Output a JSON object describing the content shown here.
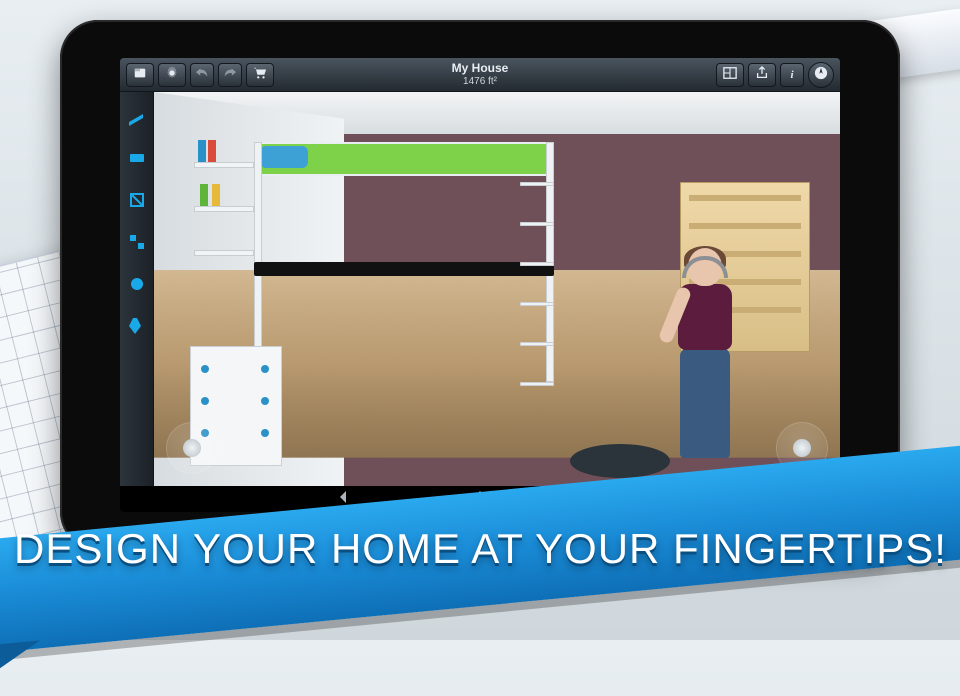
{
  "header": {
    "title": "My House",
    "subtitle": "1476 ft²"
  },
  "toolbar_left": {
    "file": "file-icon",
    "settings": "gear-icon",
    "undo": "undo-icon",
    "redo": "redo-icon",
    "cart": "cart-icon"
  },
  "toolbar_right": {
    "plan2d": "plan2d-icon",
    "share": "share-icon",
    "info": "info-icon",
    "compass": "compass-icon"
  },
  "side_rail": {
    "items": [
      {
        "name": "build-tool"
      },
      {
        "name": "furniture-tool"
      },
      {
        "name": "openings-tool"
      },
      {
        "name": "objects-tool"
      },
      {
        "name": "texture-tool"
      },
      {
        "name": "light-tool"
      }
    ]
  },
  "promo": {
    "tagline": "DESIGN YOUR HOME AT YOUR FINGERTIPS!"
  },
  "colors": {
    "accent": "#1aa9e8",
    "ribbon_top": "#2aa9ef",
    "ribbon_bottom": "#0e6fb6"
  }
}
